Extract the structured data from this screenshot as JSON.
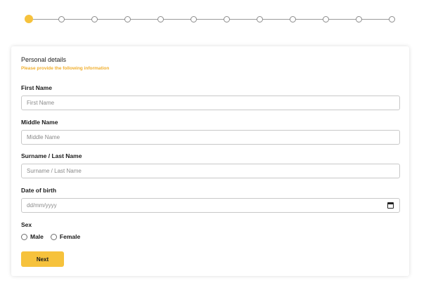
{
  "stepper": {
    "total_steps": 12,
    "current_step": 1,
    "active_color": "#f6c23c"
  },
  "form": {
    "title": "Personal details",
    "subtitle": "Please provide the following information",
    "first_name": {
      "label": "First Name",
      "placeholder": "First Name"
    },
    "middle_name": {
      "label": "Middle Name",
      "placeholder": "Middle Name"
    },
    "last_name": {
      "label": "Surname / Last Name",
      "placeholder": "Surname / Last Name"
    },
    "dob": {
      "label": "Date of birth",
      "placeholder": "dd/mm/yyyy",
      "icon": "calendar-icon"
    },
    "sex": {
      "label": "Sex",
      "options": [
        "Male",
        "Female"
      ]
    },
    "next_label": "Next"
  },
  "colors": {
    "accent": "#f6c23c",
    "subtitle": "#f0ae2d",
    "field_border": "#c8c8c8"
  }
}
